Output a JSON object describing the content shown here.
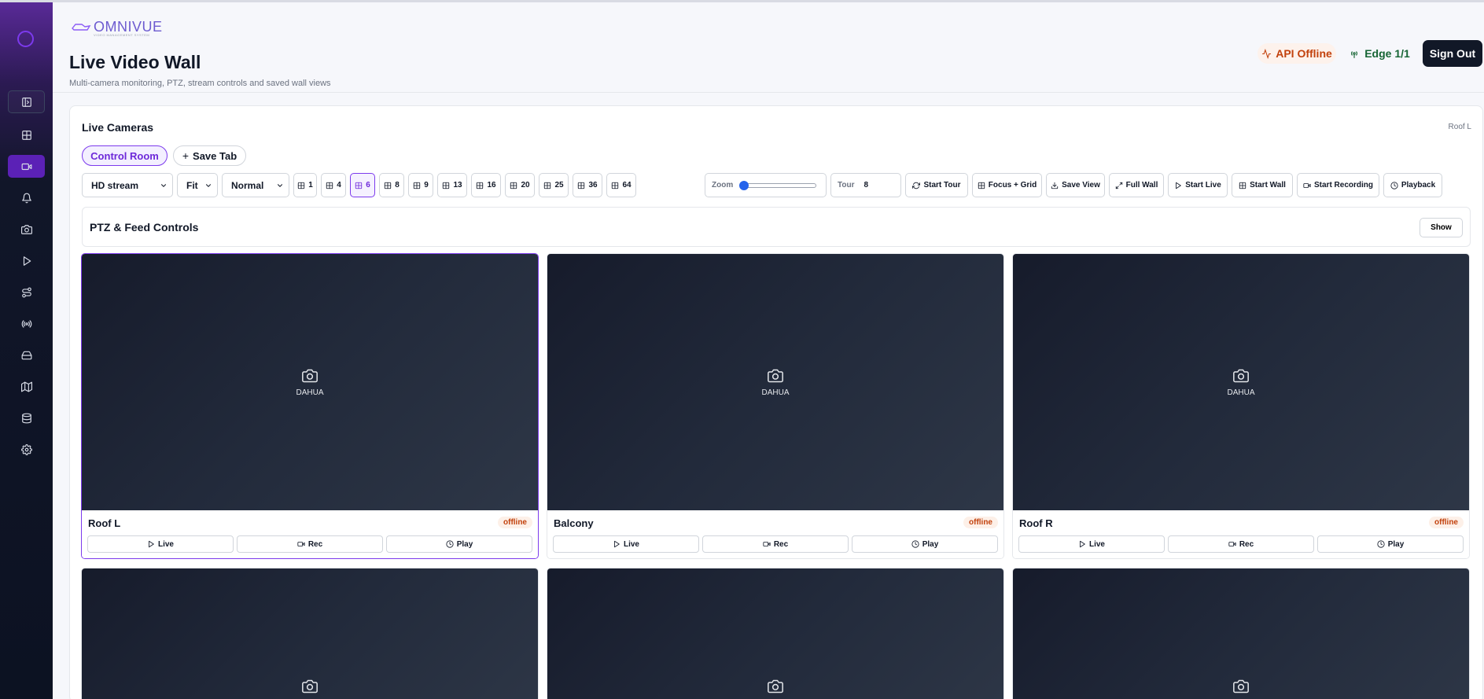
{
  "brand": {
    "name": "OMNIVUE",
    "tagline": "VIDEO MANAGEMENT SYSTEM"
  },
  "header": {
    "title": "Live Video Wall",
    "subtitle": "Multi-camera monitoring, PTZ, stream controls and saved wall views",
    "api_status": "API Offline",
    "edge_status": "Edge 1/1",
    "sign_out": "Sign Out"
  },
  "sidebar": {
    "items": [
      {
        "icon": "panel-icon",
        "state": "outlined"
      },
      {
        "icon": "grid-icon",
        "state": "default"
      },
      {
        "icon": "video-camera-icon",
        "state": "active"
      },
      {
        "icon": "bell-icon",
        "state": "default"
      },
      {
        "icon": "camera-icon",
        "state": "default"
      },
      {
        "icon": "play-icon",
        "state": "default"
      },
      {
        "icon": "route-icon",
        "state": "default"
      },
      {
        "icon": "antenna-icon",
        "state": "default"
      },
      {
        "icon": "storage-drive-icon",
        "state": "default"
      },
      {
        "icon": "map-icon",
        "state": "default"
      },
      {
        "icon": "database-icon",
        "state": "default"
      },
      {
        "icon": "gear-icon",
        "state": "default"
      }
    ]
  },
  "cameras_panel": {
    "title": "Live Cameras",
    "selected_camera": "Roof L",
    "tabs": {
      "active": "Control Room",
      "save": "Save Tab"
    },
    "stream_select": "HD stream",
    "fit_select": "Fit",
    "mode_select": "Normal",
    "layouts": [
      "1",
      "4",
      "6",
      "8",
      "9",
      "13",
      "16",
      "20",
      "25",
      "36",
      "64"
    ],
    "active_layout": "6",
    "zoom_label": "Zoom",
    "zoom_value": 0,
    "tour_label": "Tour",
    "tour_value": "8",
    "actions": [
      "Start Tour",
      "Focus + Grid",
      "Save View",
      "Full Wall",
      "Start Live",
      "Start Wall",
      "Start Recording",
      "Playback"
    ]
  },
  "ptz": {
    "title": "PTZ & Feed Controls",
    "toggle": "Show"
  },
  "tiles": [
    {
      "name": "Roof L",
      "vendor": "DAHUA",
      "status": "offline",
      "live": "Live",
      "rec": "Rec",
      "play": "Play"
    },
    {
      "name": "Balcony",
      "vendor": "DAHUA",
      "status": "offline",
      "live": "Live",
      "rec": "Rec",
      "play": "Play"
    },
    {
      "name": "Roof R",
      "vendor": "DAHUA",
      "status": "offline",
      "live": "Live",
      "rec": "Rec",
      "play": "Play"
    }
  ],
  "colors": {
    "accent": "#7c3aed",
    "danger": "#c2410c",
    "ok": "#166534",
    "sidebar": "#0c1222"
  }
}
